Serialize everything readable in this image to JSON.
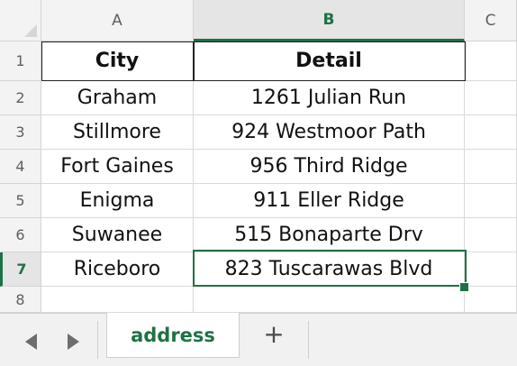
{
  "columns": [
    "A",
    "B",
    "C"
  ],
  "rows": [
    "1",
    "2",
    "3",
    "4",
    "5",
    "6",
    "7",
    "8"
  ],
  "table": {
    "headers": [
      "City",
      "Detail"
    ],
    "records": [
      {
        "city": "Graham",
        "detail": "1261 Julian Run"
      },
      {
        "city": "Stillmore",
        "detail": "924 Westmoor Path"
      },
      {
        "city": "Fort Gaines",
        "detail": "956 Third Ridge"
      },
      {
        "city": "Enigma",
        "detail": "911 Eller Ridge"
      },
      {
        "city": "Suwanee",
        "detail": "515 Bonaparte Drv"
      },
      {
        "city": "Riceboro",
        "detail": "823 Tuscarawas Blvd"
      }
    ]
  },
  "selection": {
    "column": "B",
    "row": "7"
  },
  "sheet_tabs": {
    "active": "address",
    "add_label": "+"
  },
  "colors": {
    "accent": "#1e7145",
    "header_bg": "#f3f3f3",
    "grid_line": "#dadada"
  },
  "icons": {
    "prev": "triangle-left-icon",
    "next": "triangle-right-icon",
    "add": "plus-icon"
  }
}
